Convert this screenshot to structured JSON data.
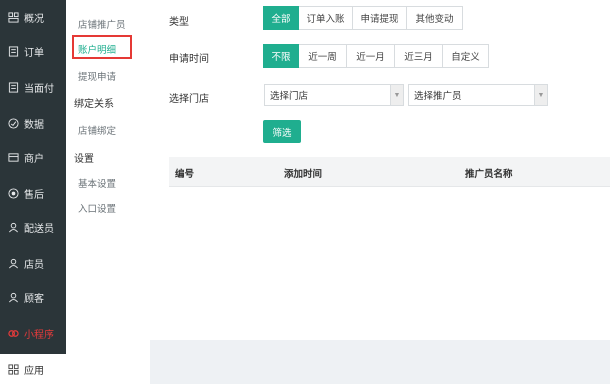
{
  "nav": {
    "items": [
      {
        "label": "概况",
        "icon": "overview-icon"
      },
      {
        "label": "订单",
        "icon": "order-icon"
      },
      {
        "label": "当面付",
        "icon": "face-pay-icon"
      },
      {
        "label": "数据",
        "icon": "data-icon"
      },
      {
        "label": "商户",
        "icon": "merchant-icon"
      },
      {
        "label": "售后",
        "icon": "after-sale-icon"
      },
      {
        "label": "配送员",
        "icon": "courier-icon"
      },
      {
        "label": "店员",
        "icon": "clerk-icon"
      },
      {
        "label": "顾客",
        "icon": "customer-icon"
      },
      {
        "label": "小程序",
        "icon": "mini-program-icon"
      },
      {
        "label": "应用",
        "icon": "apps-icon"
      }
    ]
  },
  "submenu": {
    "items": [
      {
        "label": "店铺推广员"
      },
      {
        "label": "账户明细"
      },
      {
        "label": "提现申请"
      }
    ],
    "section_bind": "绑定关系",
    "bind_items": [
      {
        "label": "店铺绑定"
      }
    ],
    "section_settings": "设置",
    "settings_items": [
      {
        "label": "基本设置"
      },
      {
        "label": "入口设置"
      }
    ]
  },
  "filters": {
    "type_label": "类型",
    "type_options": [
      "全部",
      "订单入账",
      "申请提现",
      "其他变动"
    ],
    "type_selected": "全部",
    "time_label": "申请时间",
    "time_options": [
      "不限",
      "近一周",
      "近一月",
      "近三月",
      "自定义"
    ],
    "time_selected": "不限",
    "store_label": "选择门店",
    "store_select": "选择门店",
    "promoter_select": "选择推广员",
    "filter_button": "筛选"
  },
  "table": {
    "headers": [
      "编号",
      "添加时间",
      "推广员名称"
    ]
  },
  "colors": {
    "accent": "#1fae8f",
    "nav_bg": "#2b3539",
    "highlight": "#e53935"
  }
}
